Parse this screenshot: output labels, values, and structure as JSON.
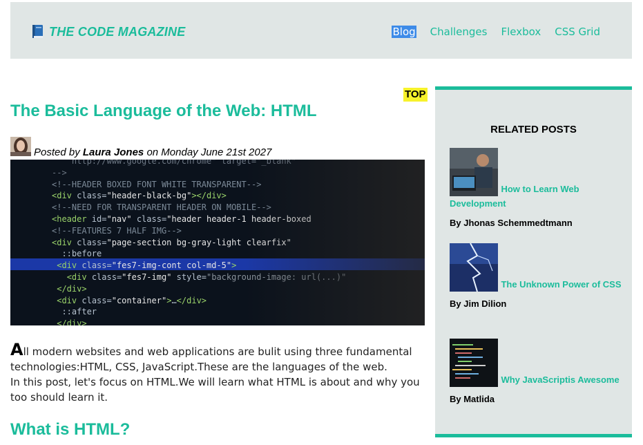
{
  "brand": {
    "name": "THE CODE MAGAZINE",
    "icon": "book-icon"
  },
  "nav": [
    {
      "label": "Blog",
      "active": true
    },
    {
      "label": "Challenges",
      "active": false
    },
    {
      "label": "Flexbox",
      "active": false
    },
    {
      "label": "CSS Grid",
      "active": false
    }
  ],
  "article": {
    "badge": "TOP",
    "title": "The Basic Language of the Web: HTML",
    "byline": {
      "prefix": "Posted by",
      "author": "Laura Jones",
      "middle": "on",
      "date": "Monday June 21st 2027"
    },
    "intro_dropcap": "A",
    "intro_line1": "ll modern websites and web applications are bulit using three fundamental technologies:HTML, CSS, JavaScript.These are the languages of the web.",
    "intro_line2": "In this post, let's focus on HTML.We will learn what HTML is about and why you too should learn it.",
    "section_title": "What is HTML?"
  },
  "sidebar": {
    "title": "RELATED POSTS",
    "posts": [
      {
        "title": "How to Learn Web Development",
        "author": "By Jhonas Schemmedtmann"
      },
      {
        "title": "The Unknown Power of CSS",
        "author": "By Jim Dilion"
      },
      {
        "title": "Why JavaScriptis Awesome",
        "author": "By Matlida"
      }
    ]
  },
  "colors": {
    "accent": "#1bbc9b",
    "header_bg": "#e0e6e5",
    "badge_bg": "#f7f22b",
    "active_nav": "#3d8be8"
  }
}
